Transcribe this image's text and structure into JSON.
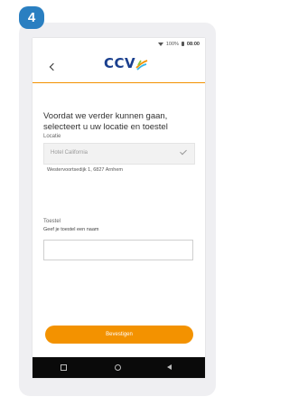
{
  "step": {
    "number": "4"
  },
  "statusbar": {
    "battery": "100%",
    "time": "08:00"
  },
  "brand": {
    "logo_text": "CCV",
    "primary_color": "#1a3f8e",
    "accent_color": "#f39200"
  },
  "screen": {
    "heading": "Voordat we verder kunnen gaan, selecteert u uw locatie en toestel",
    "location": {
      "label": "Locatie",
      "value": "Hotel California",
      "address": "Westervoortsedijk 1, 6827 Arnhem"
    },
    "device": {
      "label": "Toestel",
      "hint": "Geef je toestel een naam",
      "value": ""
    },
    "confirm_label": "Bevestigen"
  }
}
